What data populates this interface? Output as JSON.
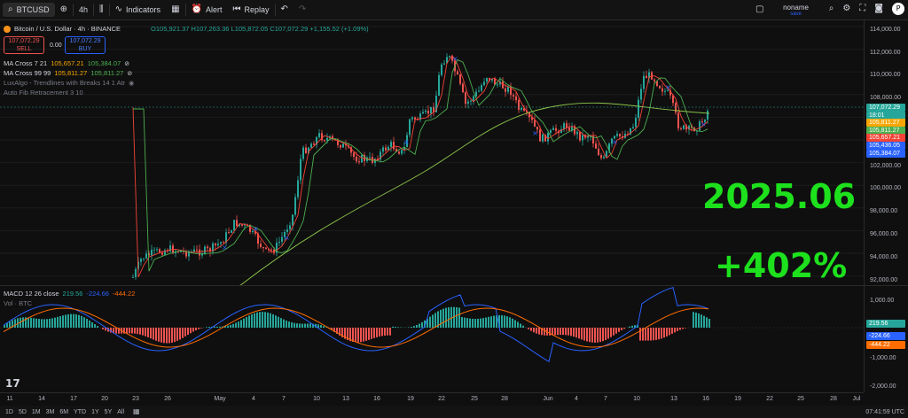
{
  "toolbar": {
    "symbol": "BTCUSD",
    "interval": "4h",
    "indicators_label": "Indicators",
    "alert_label": "Alert",
    "replay_label": "Replay",
    "account_name": "noname",
    "account_sub": "save",
    "icons": [
      "avatar-icon",
      "add-icon",
      "candles-icon",
      "indicators-icon",
      "templates-icon",
      "alert-icon",
      "replay-icon",
      "undo-icon",
      "redo-icon",
      "layout-icon",
      "search-icon",
      "settings-icon",
      "fullscreen-icon",
      "camera-icon",
      "publish-icon"
    ]
  },
  "legend": {
    "title": "Bitcoin / U.S. Dollar · 4h · BINANCE",
    "ohlc": "O105,921.37 H107,263.36 L105,872.05 C107,072.29 +1,155.52 (+1.09%)",
    "sell_price": "107,072.29",
    "sell_label": "SELL",
    "spread": "0.00",
    "buy_price": "107,072.29",
    "buy_label": "BUY",
    "ma_cross_1_name": "MA Cross 7 21",
    "ma_cross_1_v1": "105,657.21",
    "ma_cross_1_v2": "105,384.07",
    "ma_cross_2_name": "MA Cross 99 99",
    "ma_cross_2_v1": "105,811.27",
    "ma_cross_2_v2": "105,811.27",
    "luxalgo": "LuxAlgo - Trendlines with Breaks 14 1 Atr",
    "fib": "Auto Fib Retracement 3 10",
    "macd_name": "MACD 12 26 close",
    "macd_v1": "219.56",
    "macd_v2": "-224.66",
    "macd_v3": "-444.22",
    "vol": "Vol · BTC"
  },
  "price_axis": {
    "labels": [
      "114,000.00",
      "112,000.00",
      "110,000.00",
      "108,000.00",
      "104,000.00",
      "102,000.00",
      "100,000.00",
      "98,000.00",
      "96,000.00",
      "94,000.00",
      "92,000.00"
    ],
    "tags": [
      {
        "text": "107,072.29",
        "color": "#26a69a"
      },
      {
        "text": "18:01",
        "color": "#26a69a"
      },
      {
        "text": "105,811.27",
        "color": "#f7a600"
      },
      {
        "text": "105,811.27",
        "color": "#4caf50"
      },
      {
        "text": "105,657.21",
        "color": "#f44336"
      },
      {
        "text": "105,436.05",
        "color": "#2962ff"
      },
      {
        "text": "105,384.07",
        "color": "#2962ff"
      }
    ],
    "macd_labels": [
      "1,000.00",
      "-1,000.00",
      "-2,000.00"
    ],
    "macd_tags": [
      {
        "text": "219.56",
        "color": "#26a69a"
      },
      {
        "text": "-224.66",
        "color": "#2962ff"
      },
      {
        "text": "-444.22",
        "color": "#ff6d00"
      }
    ]
  },
  "time_axis": [
    "11",
    "14",
    "17",
    "20",
    "23",
    "26",
    "May",
    "4",
    "7",
    "10",
    "13",
    "16",
    "19",
    "22",
    "25",
    "28",
    "Jun",
    "4",
    "7",
    "10",
    "13",
    "16",
    "19",
    "22",
    "25",
    "28",
    "Jul"
  ],
  "overlay": {
    "date": "2025.06",
    "gain": "+402%"
  },
  "bottom": {
    "ranges": [
      "1D",
      "5D",
      "1M",
      "3M",
      "6M",
      "YTD",
      "1Y",
      "5Y",
      "All"
    ],
    "clock": "07:41:59 UTC"
  },
  "colors": {
    "up": "#26a69a",
    "down": "#ef5350",
    "ma_fast": "#f44336",
    "ma_slow": "#4caf50",
    "accent": "#1de11d"
  }
}
